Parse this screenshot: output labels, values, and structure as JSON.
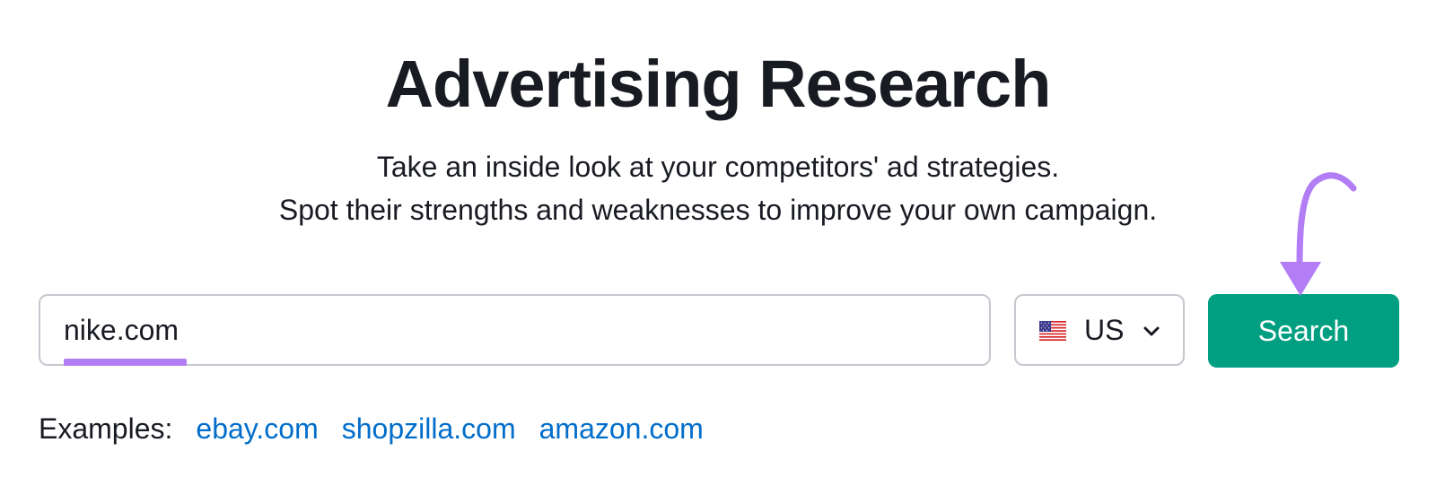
{
  "page": {
    "title": "Advertising Research",
    "subtitle_lines": [
      "Take an inside look at your competitors' ad strategies.",
      "Spot their strengths and weaknesses to improve your own campaign."
    ]
  },
  "search": {
    "value": "nike.com"
  },
  "country": {
    "code": "US",
    "flag_icon": "us-flag-icon"
  },
  "button": {
    "label": "Search",
    "color": "#009f81"
  },
  "examples": {
    "label": "Examples:",
    "links": [
      "ebay.com",
      "shopzilla.com",
      "amazon.com"
    ],
    "link_color": "#006dca"
  },
  "annotations": {
    "highlight_color": "#b27df5"
  }
}
